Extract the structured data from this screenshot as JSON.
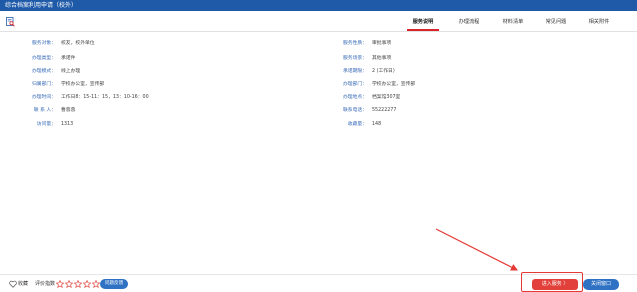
{
  "window": {
    "title": "综合档案利用申请（校外）"
  },
  "tabs": [
    {
      "label": "服务说明",
      "active": true
    },
    {
      "label": "办理流程",
      "active": false
    },
    {
      "label": "材料清单",
      "active": false
    },
    {
      "label": "常见问题",
      "active": false
    },
    {
      "label": "相关附件",
      "active": false
    }
  ],
  "details_left": [
    {
      "label": "服务对象：",
      "value": "校友，校外单位"
    },
    {
      "label": "办理类型：",
      "value": "承诺件"
    },
    {
      "label": "办理模式：",
      "value": "线上办理"
    },
    {
      "label": "归属部门：",
      "value": "学校办公室，宣传部"
    },
    {
      "label": "办理时间：",
      "value": "工作日8：15-11：15，13：10-16：00"
    },
    {
      "label": "联 系 人：",
      "value": "曹蓉蓉"
    },
    {
      "label": "访问量：",
      "value": "1313"
    }
  ],
  "details_right": [
    {
      "label": "服务性质：",
      "value": "审批事项"
    },
    {
      "label": "服务场景：",
      "value": "其他事项"
    },
    {
      "label": "承诺期限：",
      "value": "2 (工作日)"
    },
    {
      "label": "办理部门：",
      "value": "学校办公室，宣传部"
    },
    {
      "label": "办理地点：",
      "value": "档案馆307室"
    },
    {
      "label": "联系电话：",
      "value": "55222277"
    },
    {
      "label": "收藏量：",
      "value": "148"
    }
  ],
  "footer": {
    "favorite_label": "收藏",
    "rating_label": "评价指数",
    "rating_stars": 0,
    "feedback_label": "问题反馈",
    "enter_label": "进入服务 〉",
    "close_label": "关闭窗口"
  },
  "colors": {
    "title_bar": "#1e5aa8",
    "label_blue": "#3b6db8",
    "active_tab_underline": "#d9262c",
    "primary_red": "#e2403a",
    "button_blue": "#2f72c4"
  },
  "icons": [
    "document-search-icon",
    "heart-icon",
    "star-icon"
  ]
}
